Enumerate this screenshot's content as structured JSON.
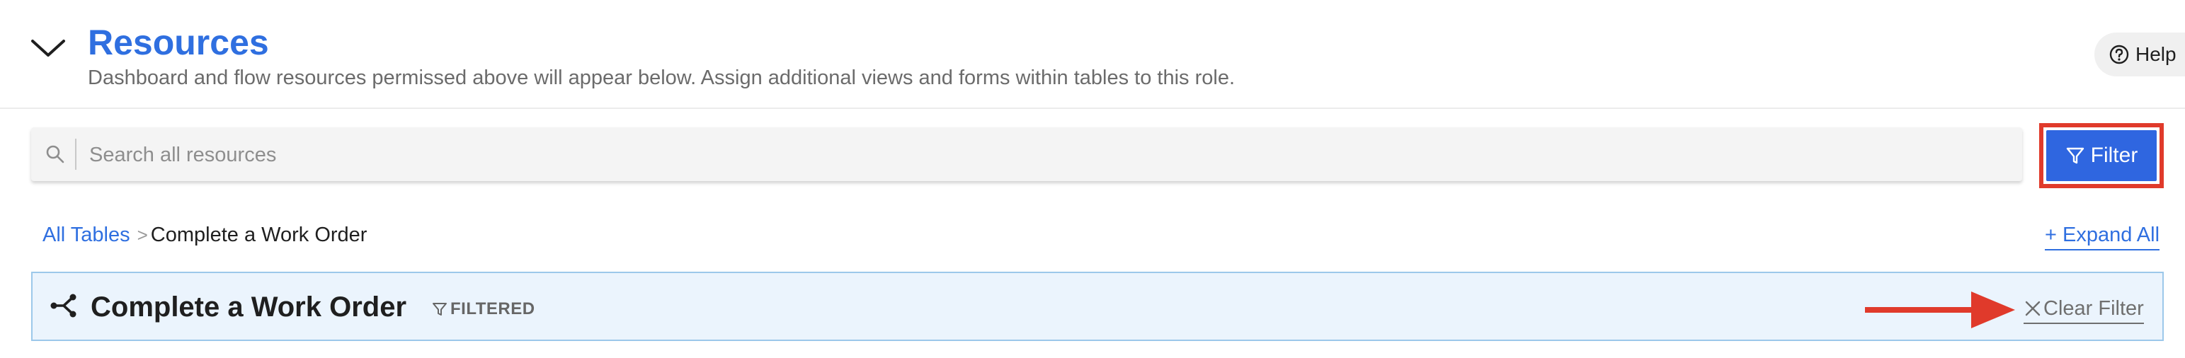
{
  "header": {
    "title": "Resources",
    "subtitle": "Dashboard and flow resources permissed above will appear below. Assign additional views and forms within tables to this role.",
    "help_label": "Help"
  },
  "search": {
    "placeholder": "Search all resources",
    "value": ""
  },
  "toolbar": {
    "filter_label": "Filter"
  },
  "breadcrumb": {
    "root": "All Tables",
    "separator": ">",
    "current": "Complete a Work Order"
  },
  "expand_all_label": "+ Expand All",
  "group": {
    "title": "Complete a Work Order",
    "filtered_tag": "FILTERED",
    "clear_filter_label": "Clear Filter"
  },
  "colors": {
    "accent": "#2f6fe0",
    "filter_button": "#2f66e0",
    "highlight_red": "#e03a2b",
    "group_bg": "#ebf4fd",
    "group_border": "#9cc8ea"
  },
  "icons": {
    "collapse": "chevron-down-icon",
    "help": "question-circle-icon",
    "search": "search-icon",
    "filter": "filter-funnel-icon",
    "flow": "flow-branch-icon",
    "clear": "close-icon",
    "annotation": "arrow-right-icon"
  }
}
